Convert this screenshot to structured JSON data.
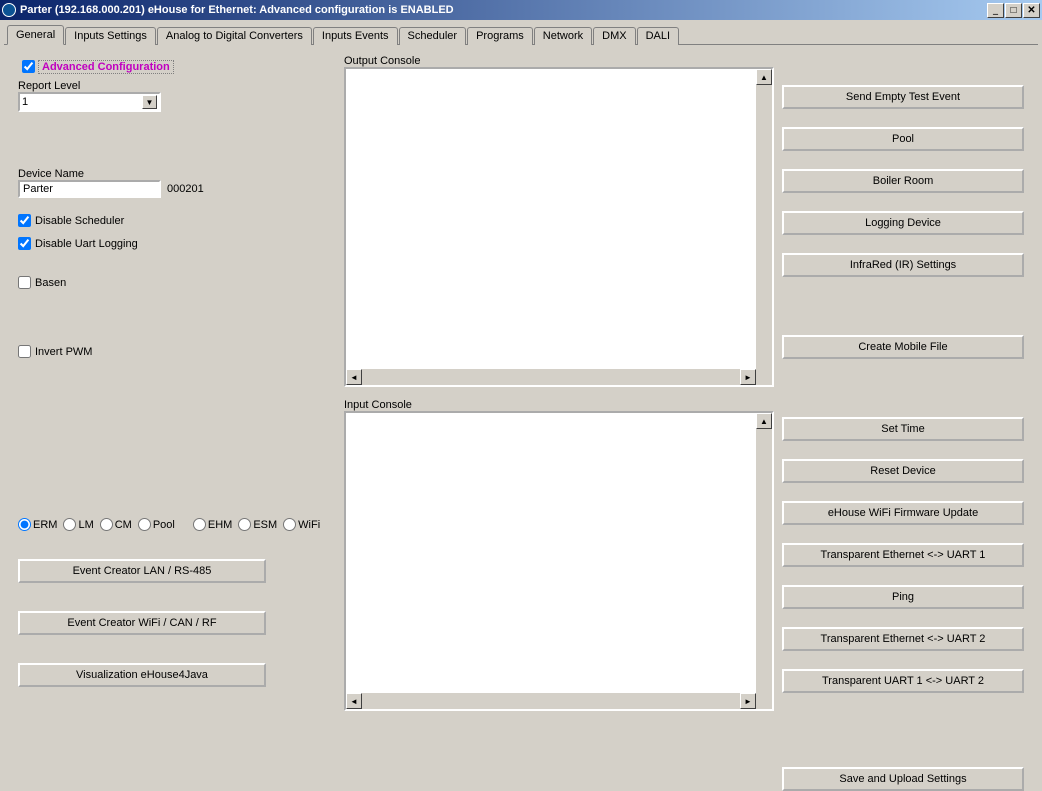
{
  "window": {
    "title": "Parter (192.168.000.201)     eHouse for Ethernet: Advanced configuration is ENABLED"
  },
  "tabs": [
    "General",
    "Inputs Settings",
    "Analog to Digital Converters",
    "Inputs Events",
    "Scheduler",
    "Programs",
    "Network",
    "DMX",
    "DALI"
  ],
  "left": {
    "advanced_label": "Advanced Configuration",
    "advanced_checked": true,
    "report_level_label": "Report Level",
    "report_level_value": "1",
    "device_name_label": "Device Name",
    "device_name_value": "Parter",
    "device_id": "000201",
    "disable_scheduler": {
      "label": "Disable Scheduler",
      "checked": true
    },
    "disable_uart": {
      "label": "Disable Uart Logging",
      "checked": true
    },
    "basen": {
      "label": "Basen",
      "checked": false
    },
    "invert_pwm": {
      "label": "Invert PWM",
      "checked": false
    },
    "radios": [
      "ERM",
      "LM",
      "CM",
      "Pool",
      "EHM",
      "ESM",
      "WiFi"
    ],
    "radio_selected": "ERM",
    "btn_lan": "Event Creator LAN / RS-485",
    "btn_wifi": "Event Creator WiFi / CAN / RF",
    "btn_viz": "Visualization eHouse4Java"
  },
  "middle": {
    "output_label": "Output Console",
    "input_label": "Input Console"
  },
  "right": {
    "buttons1": [
      "Send Empty Test Event",
      "Pool",
      "Boiler Room",
      "Logging Device",
      "InfraRed (IR) Settings"
    ],
    "buttons2": [
      "Create Mobile File"
    ],
    "buttons3": [
      "Set Time",
      "Reset Device",
      "eHouse WiFi Firmware Update",
      "Transparent Ethernet <-> UART 1",
      "Ping",
      "Transparent Ethernet <-> UART 2",
      "Transparent UART 1 <-> UART 2"
    ],
    "save": "Save and Upload Settings"
  }
}
